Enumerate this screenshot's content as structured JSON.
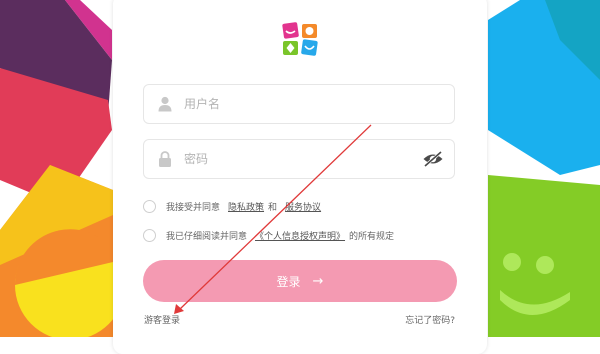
{
  "login_form": {
    "username_placeholder": "用户名",
    "password_placeholder": "密码",
    "agreement_1": {
      "prefix": "我接受并同意",
      "privacy_link": "隐私政策",
      "conjunction": "和",
      "service_link": "服务协议"
    },
    "agreement_2": {
      "prefix": "我已仔细阅读并同意",
      "auth_link": "《个人信息授权声明》",
      "suffix": "的所有规定"
    },
    "login_button": "登录",
    "guest_login": "游客登录",
    "forgot_password": "忘记了密码?"
  },
  "colors": {
    "button": "#f49ab2",
    "annotation_arrow": "#e03a3a"
  },
  "icons": {
    "logo": "smiley-tiles-logo",
    "username": "user-icon",
    "password": "lock-icon",
    "visibility": "eye-off-icon",
    "button_arrow": "arrow-right-icon"
  }
}
